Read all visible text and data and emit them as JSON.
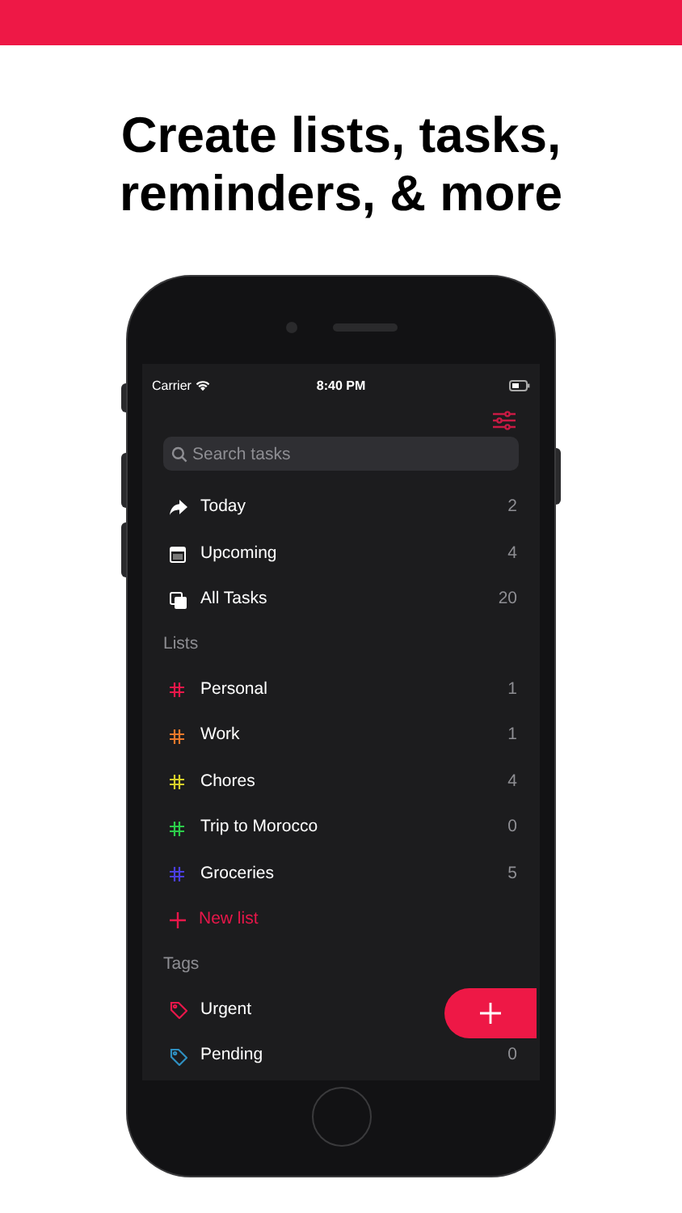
{
  "headline": "Create lists, tasks, reminders, & more",
  "status_bar": {
    "carrier": "Carrier",
    "time": "8:40 PM"
  },
  "search": {
    "placeholder": "Search tasks"
  },
  "smart_lists": [
    {
      "kind": "today",
      "label": "Today",
      "count": "2"
    },
    {
      "kind": "upcoming",
      "label": "Upcoming",
      "count": "4"
    },
    {
      "kind": "all",
      "label": "All Tasks",
      "count": "20"
    }
  ],
  "lists_header": "Lists",
  "lists": [
    {
      "label": "Personal",
      "count": "1",
      "color": "#e8174a"
    },
    {
      "label": "Work",
      "count": "1",
      "color": "#e8782a"
    },
    {
      "label": "Chores",
      "count": "4",
      "color": "#d8d02a"
    },
    {
      "label": "Trip to Morocco",
      "count": "0",
      "color": "#2ccc4a"
    },
    {
      "label": "Groceries",
      "count": "5",
      "color": "#4a3ee0"
    }
  ],
  "new_list": "New list",
  "tags_header": "Tags",
  "tags": [
    {
      "label": "Urgent",
      "color": "#e8174a"
    },
    {
      "label": "Pending",
      "count": "0",
      "color": "#2f8fc0"
    }
  ]
}
